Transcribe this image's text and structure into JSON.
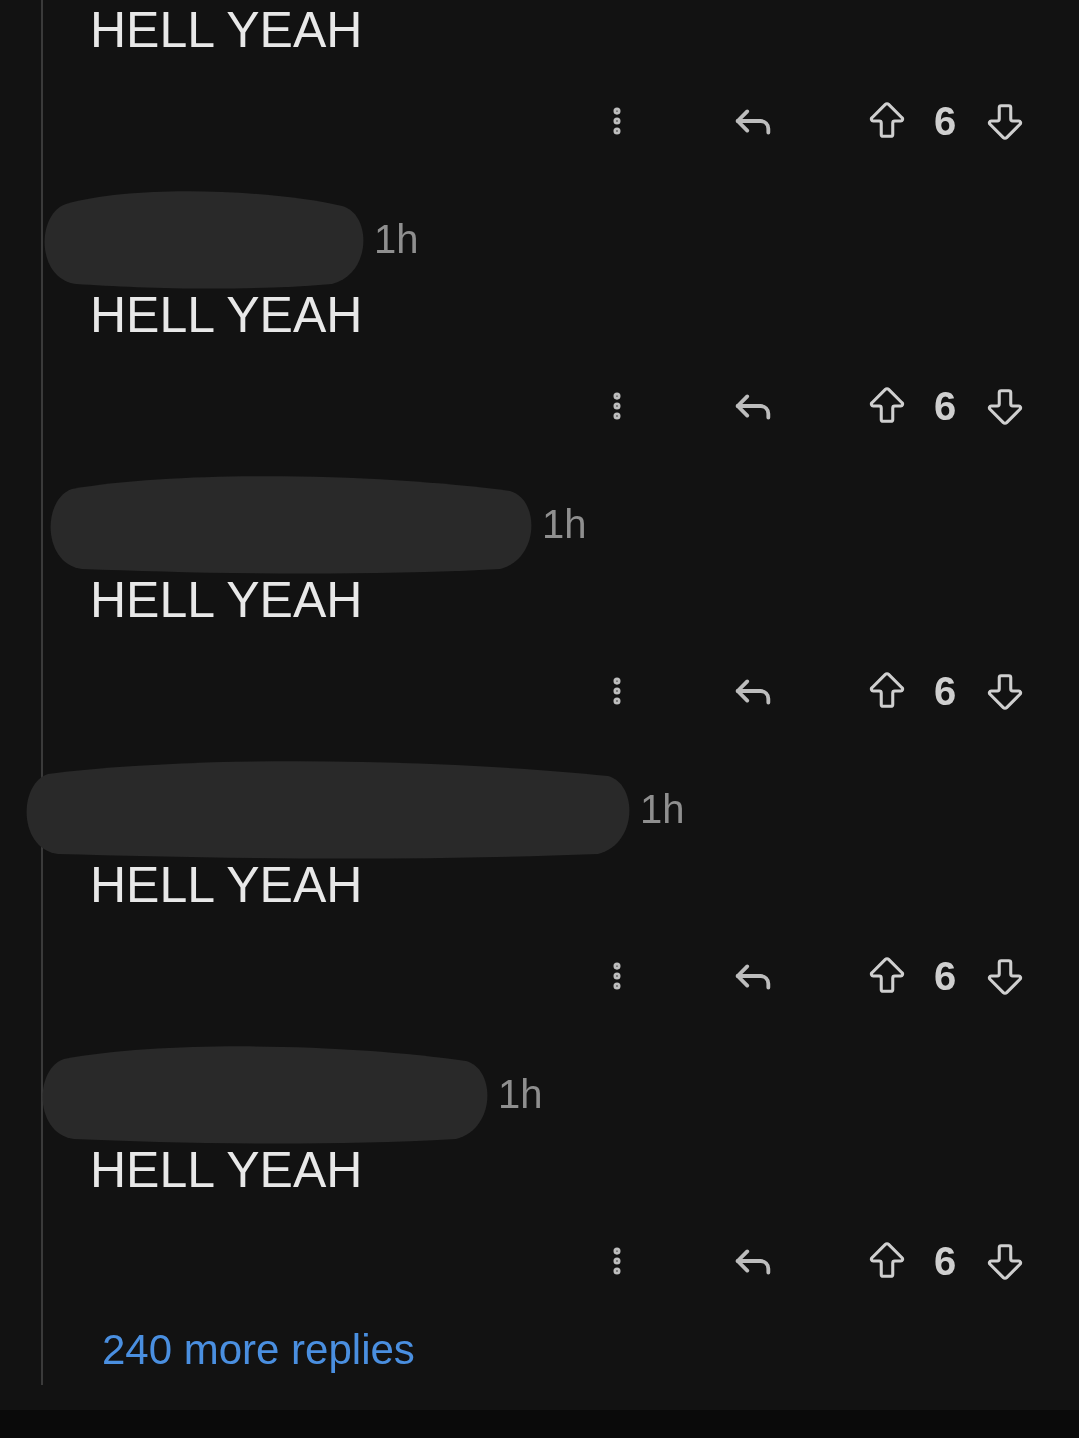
{
  "comments": [
    {
      "body": "HELL YEAH",
      "score": "6"
    },
    {
      "time": "1h",
      "body": "HELL YEAH",
      "score": "6"
    },
    {
      "time": "1h",
      "body": "HELL YEAH",
      "score": "6"
    },
    {
      "time": "1h",
      "body": "HELL YEAH",
      "score": "6"
    },
    {
      "time": "1h",
      "body": "HELL YEAH",
      "score": "6"
    }
  ],
  "more_replies": "240 more replies"
}
